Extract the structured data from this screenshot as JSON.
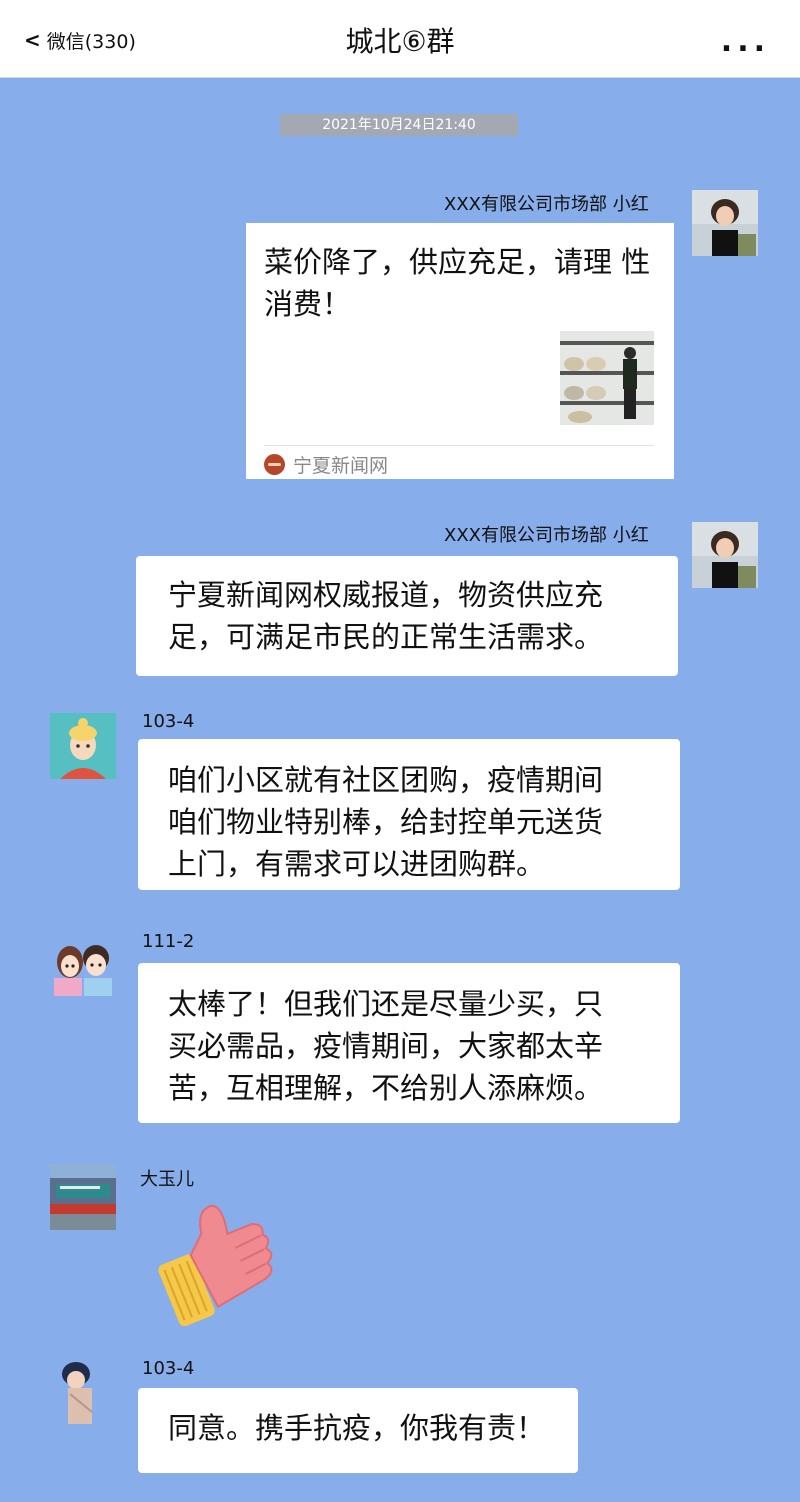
{
  "header": {
    "back_label": "微信(330)",
    "back_icon": "chevron-left-icon",
    "title": "城北⑥群",
    "more_label": "..."
  },
  "timestamp": "2021年10月24日21:40",
  "colors": {
    "chat_background": "#87adeb",
    "header_background": "#ffffff",
    "bubble": "#ffffff",
    "timestamp_pill": "#a4a8b3"
  },
  "messages": [
    {
      "sender": "XXX有限公司市场部  小红",
      "side": "right",
      "type": "link",
      "text": "菜价降了，供应充足，请理\n性消费！",
      "source": "宁夏新闻网"
    },
    {
      "sender": "XXX有限公司市场部  小红",
      "side": "right",
      "type": "text",
      "text": "宁夏新闻网权威报道，物资供应充\n足，可满足市民的正常生活需求。"
    },
    {
      "sender": "103-4",
      "side": "left",
      "type": "text",
      "text": "咱们小区就有社区团购，疫情期间\n咱们物业特别棒，给封控单元送货\n上门，有需求可以进团购群。"
    },
    {
      "sender": "111-2",
      "side": "left",
      "type": "text",
      "text": "太棒了！但我们还是尽量少买，只\n买必需品，疫情期间，大家都太辛\n苦，互相理解，不给别人添麻烦。"
    },
    {
      "sender": "大玉儿",
      "side": "left",
      "type": "sticker",
      "sticker": "thumbs-up-sticker"
    },
    {
      "sender": "103-4",
      "side": "left",
      "type": "text",
      "text": "同意。携手抗疫，你我有责！"
    }
  ]
}
